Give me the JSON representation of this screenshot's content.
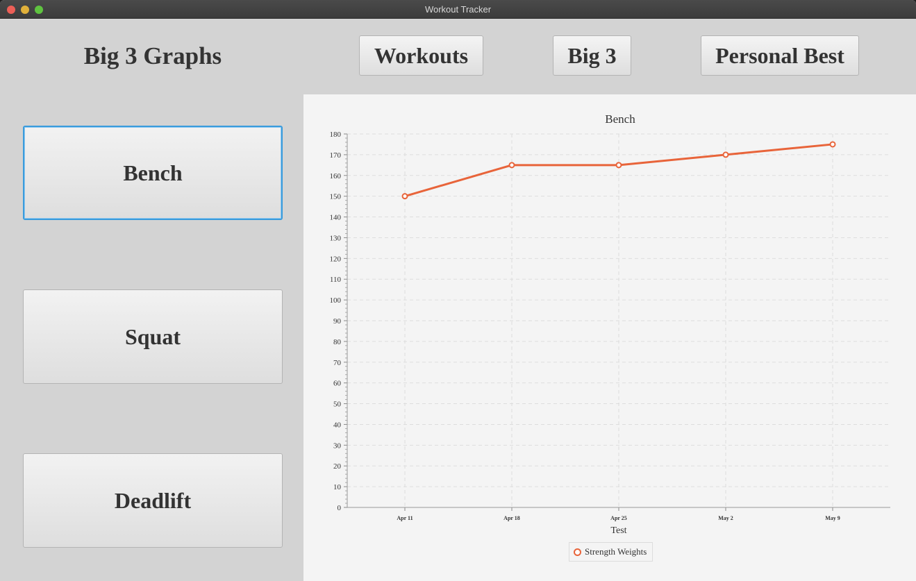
{
  "window": {
    "title": "Workout Tracker"
  },
  "header": {
    "section_title": "Big 3 Graphs",
    "nav": {
      "workouts": "Workouts",
      "big3": "Big 3",
      "personal_best": "Personal Best"
    }
  },
  "sidebar": {
    "bench": "Bench",
    "squat": "Squat",
    "deadlift": "Deadlift"
  },
  "colors": {
    "series": "#e8643a",
    "focus": "#3a9bdc"
  },
  "chart_data": {
    "type": "line",
    "title": "Bench",
    "xlabel": "Test",
    "ylabel": "",
    "categories": [
      "Apr 11",
      "Apr 18",
      "Apr 25",
      "May 2",
      "May 9"
    ],
    "series": [
      {
        "name": "Strength Weights",
        "values": [
          150,
          165,
          165,
          170,
          175
        ]
      }
    ],
    "ylim": [
      0,
      180
    ],
    "ytick_step": 10,
    "grid": true,
    "legend": "bottom"
  }
}
